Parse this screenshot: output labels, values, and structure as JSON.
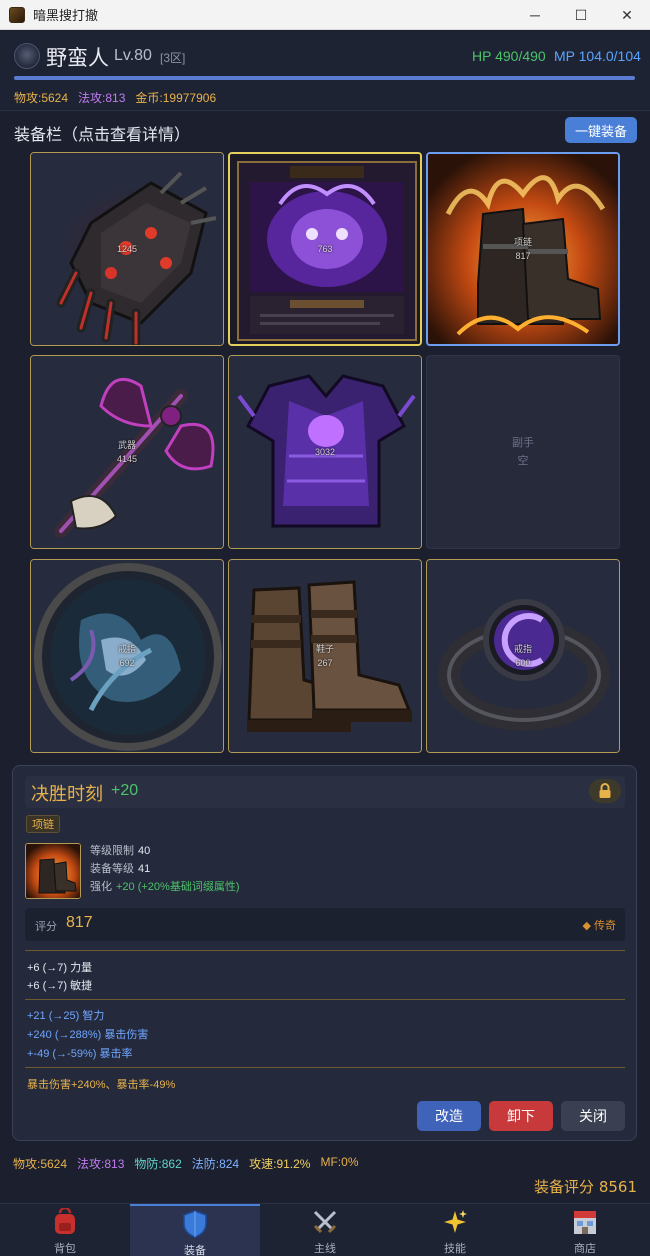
{
  "window": {
    "title": "暗黑搜打撤",
    "controls": [
      "─",
      "☐",
      "✕"
    ]
  },
  "character": {
    "name": "野蛮人",
    "level": "Lv.80",
    "server": "[3区]",
    "hp": "HP 490/490",
    "mp": "MP 104.0/104",
    "xp_fraction": 1.0,
    "phys_attack": "物攻:5624",
    "mag_attack": "法攻:813",
    "gold": "金币:19977906"
  },
  "equipment": {
    "title": "装备栏（点击查看详情）",
    "auto_equip_label": "一键装备",
    "slots": [
      {
        "id": "gloves",
        "label": "",
        "value": "1245",
        "icon": "gauntlet-icon"
      },
      {
        "id": "necklace",
        "label": "",
        "value": "763",
        "icon": "void-shadow-icon"
      },
      {
        "id": "boots-fire",
        "label": "项链",
        "value": "817",
        "icon": "fire-boots-icon"
      },
      {
        "id": "weapon",
        "label": "武器",
        "value": "4145",
        "icon": "axe-icon"
      },
      {
        "id": "armor",
        "label": "",
        "value": "3032",
        "icon": "armor-icon"
      },
      {
        "id": "offhand",
        "label": "副手",
        "value": "空",
        "icon": ""
      },
      {
        "id": "amulet",
        "label": "戒指",
        "value": "692",
        "icon": "orb-icon"
      },
      {
        "id": "shoes",
        "label": "鞋子",
        "value": "267",
        "icon": "boots-icon"
      },
      {
        "id": "ring",
        "label": "戒指",
        "value": "600",
        "icon": "ring-icon"
      }
    ]
  },
  "detail": {
    "name": "决胜时刻",
    "plus": "+20",
    "lock_icon": "lock-icon",
    "type": "项链",
    "level_req_label": "等级限制",
    "level_req": "40",
    "equip_level_label": "装备等级",
    "equip_level": "41",
    "enhance_label": "强化",
    "enhance_value": "+20 (+20%基础词缀属性)",
    "score_label": "评分",
    "score": "817",
    "rarity": "◆ 传奇",
    "base_attrs": [
      "+6 (→7) 力量",
      "+6 (→7) 敏捷"
    ],
    "magic_attrs": [
      "+21 (→25) 智力",
      "+240 (→288%) 暴击伤害",
      "+-49 (→-59%) 暴击率"
    ],
    "special": "暴击伤害+240%、暴击率-49%",
    "buttons": {
      "reforge": "改造",
      "unequip": "卸下",
      "close": "关闭"
    }
  },
  "bottom_stats": {
    "phys_attack": "物攻:5624",
    "mag_attack": "法攻:813",
    "phys_def": "物防:862",
    "mag_def": "法防:824",
    "atk_speed": "攻速:91.2%",
    "mf": "MF:0%"
  },
  "total_score": "装备评分 8561",
  "nav": [
    {
      "label": "背包",
      "icon": "backpack-icon"
    },
    {
      "label": "装备",
      "icon": "shield-icon"
    },
    {
      "label": "主线",
      "icon": "crossed-swords-icon"
    },
    {
      "label": "技能",
      "icon": "sparkles-icon"
    },
    {
      "label": "商店",
      "icon": "store-icon"
    }
  ],
  "colors": {
    "accent": "#4a7fd8",
    "gold": "#e8b24a",
    "hp": "#4cc26a",
    "mp": "#5aa4ff",
    "danger": "#d04545"
  }
}
